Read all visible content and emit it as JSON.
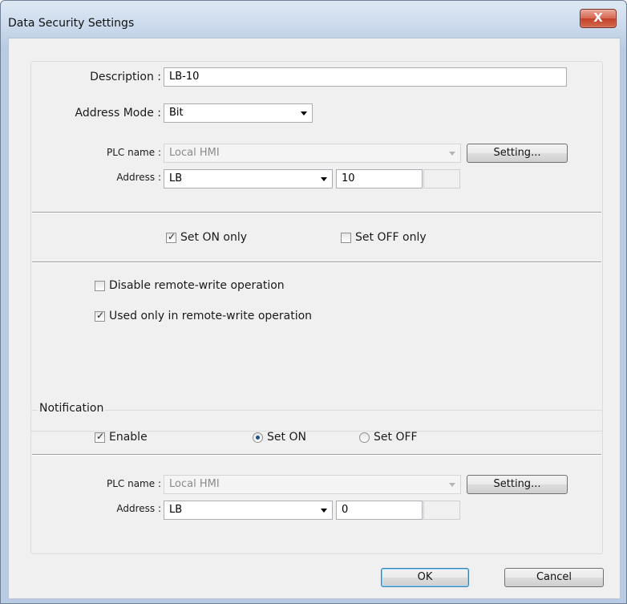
{
  "window": {
    "title": "Data Security Settings",
    "close_glyph": "X"
  },
  "main": {
    "description_label": "Description :",
    "description_value": "LB-10",
    "address_mode_label": "Address Mode :",
    "address_mode_value": "Bit",
    "plc_name_label": "PLC name :",
    "plc_name_value": "Local HMI",
    "setting_label": "Setting...",
    "address_label": "Address :",
    "address_device": "LB",
    "address_value": "10",
    "set_on_only_label": "Set ON only",
    "set_on_only_checked": true,
    "set_off_only_label": "Set OFF only",
    "set_off_only_checked": false,
    "disable_remote_label": "Disable remote-write operation",
    "disable_remote_checked": false,
    "used_only_remote_label": "Used only in remote-write operation",
    "used_only_remote_checked": true
  },
  "notification": {
    "legend": "Notification",
    "enable_label": "Enable",
    "enable_checked": true,
    "set_on_label": "Set ON",
    "set_off_label": "Set OFF",
    "selected": "Set ON",
    "plc_name_label": "PLC name :",
    "plc_name_value": "Local HMI",
    "setting_label": "Setting...",
    "address_label": "Address :",
    "address_device": "LB",
    "address_value": "0"
  },
  "footer": {
    "ok_label": "OK",
    "cancel_label": "Cancel"
  },
  "colors": {
    "titlebar": "#c6d6ea",
    "close_button": "#c4402a",
    "dialog_bg": "#f0f0f0"
  }
}
